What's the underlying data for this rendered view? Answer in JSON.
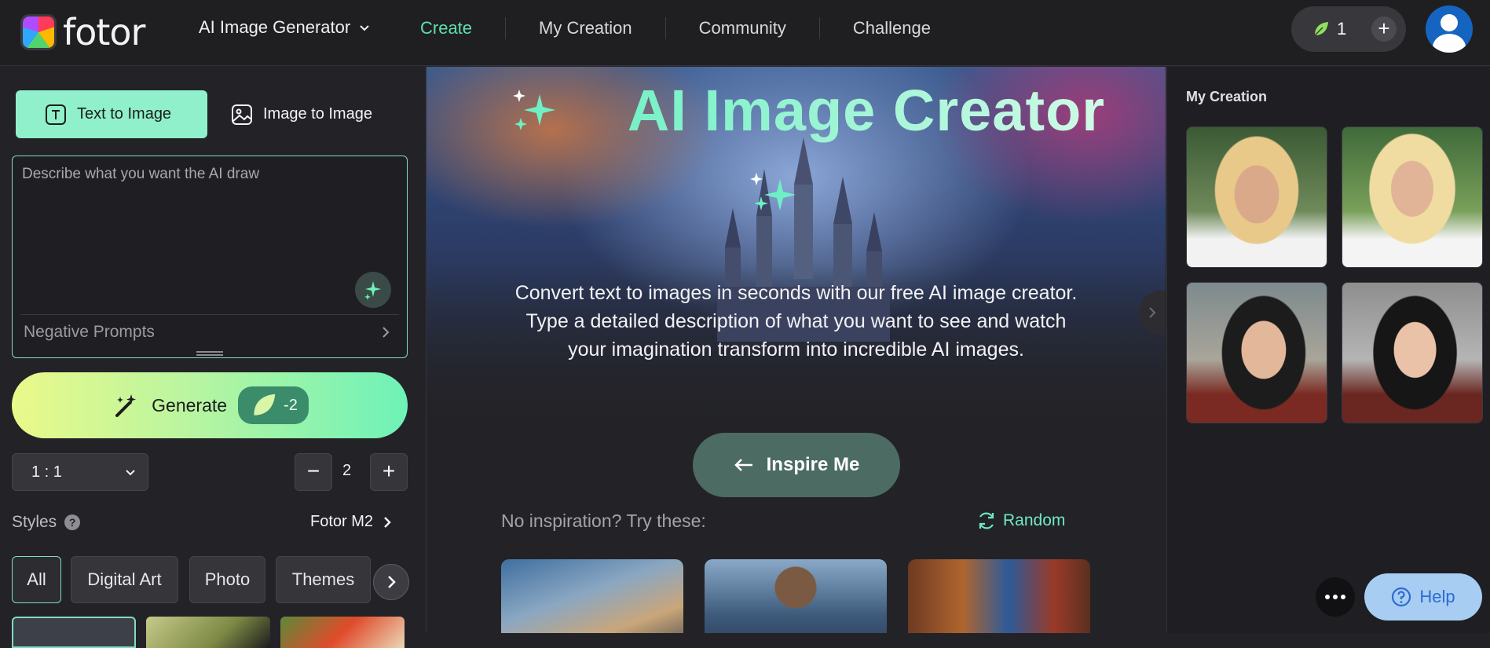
{
  "header": {
    "logo_text": "fotor",
    "generator_menu_label": "AI Image Generator",
    "nav": [
      {
        "label": "Create",
        "active": true
      },
      {
        "label": "My Creation",
        "active": false
      },
      {
        "label": "Community",
        "active": false
      },
      {
        "label": "Challenge",
        "active": false
      }
    ],
    "credits_count": "1",
    "add_credits_icon": "plus-icon",
    "avatar_icon": "user-avatar-icon"
  },
  "left_panel": {
    "modes": [
      {
        "label": "Text to Image",
        "icon": "text-box-icon",
        "active": true
      },
      {
        "label": "Image to Image",
        "icon": "image-icon",
        "active": false
      }
    ],
    "prompt": {
      "value": "",
      "placeholder": "Describe what you want the AI draw"
    },
    "negative_prompts_label": "Negative Prompts",
    "generate": {
      "label": "Generate",
      "cost": "-2"
    },
    "aspect_ratio": "1 : 1",
    "quantity": {
      "value": "2",
      "minus": "−",
      "plus": "+"
    },
    "styles": {
      "label": "Styles",
      "help_icon": "?",
      "model": "Fotor M2",
      "chips": [
        {
          "label": "All",
          "selected": true
        },
        {
          "label": "Digital Art",
          "selected": false
        },
        {
          "label": "Photo",
          "selected": false
        },
        {
          "label": "Themes",
          "selected": false
        }
      ]
    }
  },
  "center": {
    "title": "AI Image Creator",
    "description": "Convert text to images in seconds with our free AI image creator. Type a detailed description of what you want to see and watch your imagination transform into incredible AI images.",
    "inspire_button": "Inspire Me",
    "no_inspiration": "No inspiration? Try these:",
    "random_label": "Random"
  },
  "right_panel": {
    "title": "My Creation"
  },
  "floating": {
    "help_label": "Help"
  },
  "colors": {
    "accent": "#5ee0ad",
    "background": "#232327",
    "generate_gradient_start": "#eaf98a",
    "generate_gradient_end": "#6ef2b8"
  }
}
